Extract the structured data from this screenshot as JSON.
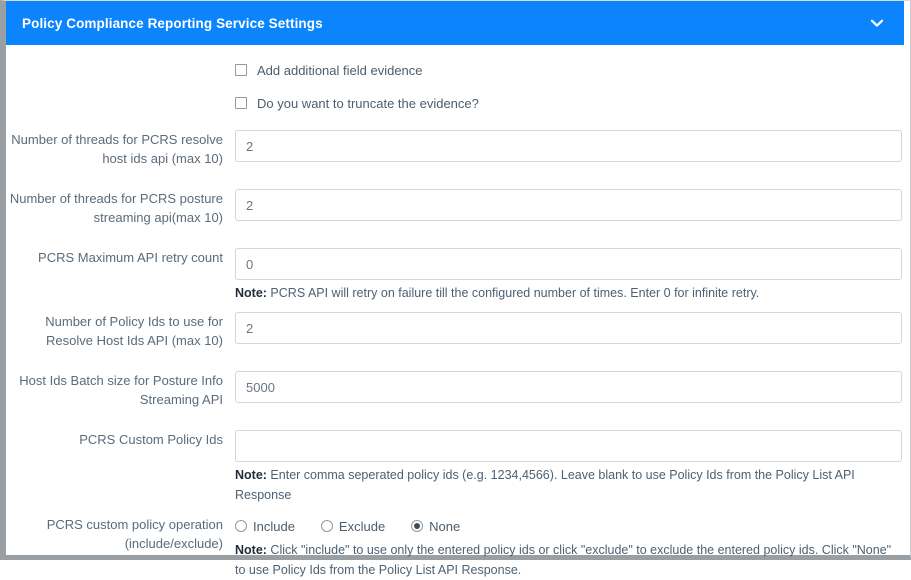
{
  "header": {
    "title": "Policy Compliance Reporting Service Settings",
    "collapse_icon": "chevron-down-icon",
    "accent_color": "#0b84fe",
    "title_color": "#ffffff"
  },
  "checkboxes": [
    {
      "label": "Add additional field evidence",
      "checked": false
    },
    {
      "label": "Do you want to truncate the evidence?",
      "checked": false
    }
  ],
  "fields": [
    {
      "label": "Number of threads for PCRS resolve host ids api (max 10)",
      "value": "2",
      "placeholder": ""
    },
    {
      "label": "Number of threads for PCRS posture streaming api(max 10)",
      "value": "2",
      "placeholder": ""
    },
    {
      "label": "PCRS Maximum API retry count",
      "value": "0",
      "placeholder": "",
      "note_prefix": "Note:",
      "note": " PCRS API will retry on failure till the configured number of times. Enter 0 for infinite retry."
    },
    {
      "label": "Number of Policy Ids to use for Resolve Host Ids API (max 10)",
      "value": "2",
      "placeholder": ""
    },
    {
      "label": "Host Ids Batch size for Posture Info Streaming API",
      "value": "5000",
      "placeholder": ""
    },
    {
      "label": "PCRS Custom Policy Ids",
      "value": "",
      "placeholder": "",
      "note_prefix": "Note:",
      "note": " Enter comma seperated policy ids (e.g. 1234,4566). Leave blank to use Policy Ids from the Policy List API Response"
    }
  ],
  "policy_operation": {
    "label": "PCRS custom policy operation (include/exclude)",
    "options": [
      {
        "label": "Include",
        "selected": false
      },
      {
        "label": "Exclude",
        "selected": false
      },
      {
        "label": "None",
        "selected": true
      }
    ],
    "note_prefix": "Note:",
    "note": " Click \"include\" to use only the entered policy ids or click \"exclude\" to exclude the entered policy ids. Click \"None\" to use Policy Ids from the Policy List API Response."
  },
  "colors": {
    "label_text": "#5b6b7a",
    "input_border": "#d3d6da",
    "note_text": "#4d6173",
    "frame": "#9a9fa4"
  }
}
